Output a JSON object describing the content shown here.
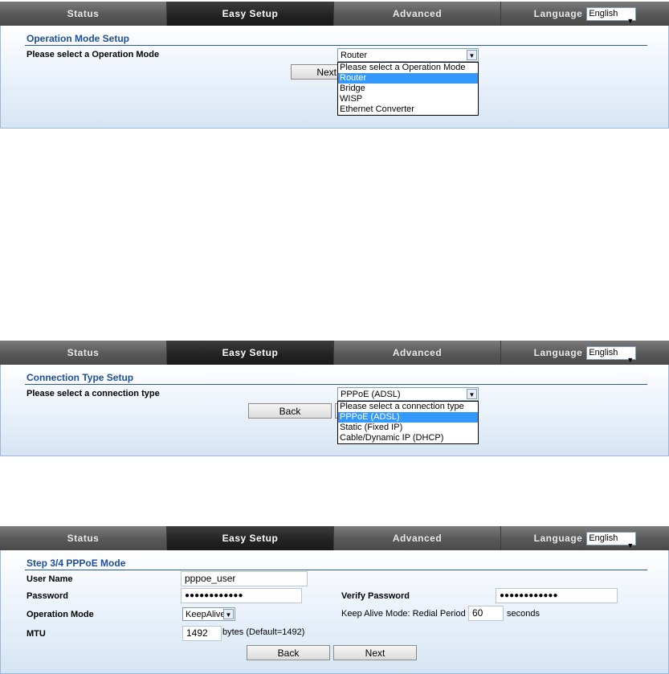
{
  "nav": {
    "tabs": [
      "Status",
      "Easy Setup",
      "Advanced"
    ],
    "language_label": "Language",
    "language_value": "English"
  },
  "op_mode": {
    "title": "Operation Mode Setup",
    "label": "Please select a Operation Mode",
    "selected": "Router",
    "options": [
      "Please select a Operation Mode",
      "Router",
      "Bridge",
      "WISP",
      "Ethernet Converter"
    ],
    "next_label": "Next"
  },
  "conn_type": {
    "title": "Connection Type Setup",
    "label": "Please select a connection type",
    "selected": "PPPoE (ADSL)",
    "options": [
      "Please select a connection type",
      "PPPoE (ADSL)",
      "Static (Fixed IP)",
      "Cable/Dynamic IP (DHCP)"
    ],
    "back_label": "Back"
  },
  "pppoe": {
    "title": "Step 3/4 PPPoE Mode",
    "user_name_label": "User Name",
    "user_name_value": "pppoe_user",
    "password_label": "Password",
    "password_value": "●●●●●●●●●●●●",
    "verify_password_label": "Verify Password",
    "verify_password_value": "●●●●●●●●●●●●",
    "operation_mode_label": "Operation Mode",
    "operation_mode_value": "KeepAlive",
    "keepalive_label": "Keep Alive Mode: Redial Period",
    "redial_value": "60",
    "redial_unit": "seconds",
    "mtu_label": "MTU",
    "mtu_value": "1492",
    "mtu_hint": "bytes (Default=1492)",
    "back_label": "Back",
    "next_label": "Next"
  }
}
